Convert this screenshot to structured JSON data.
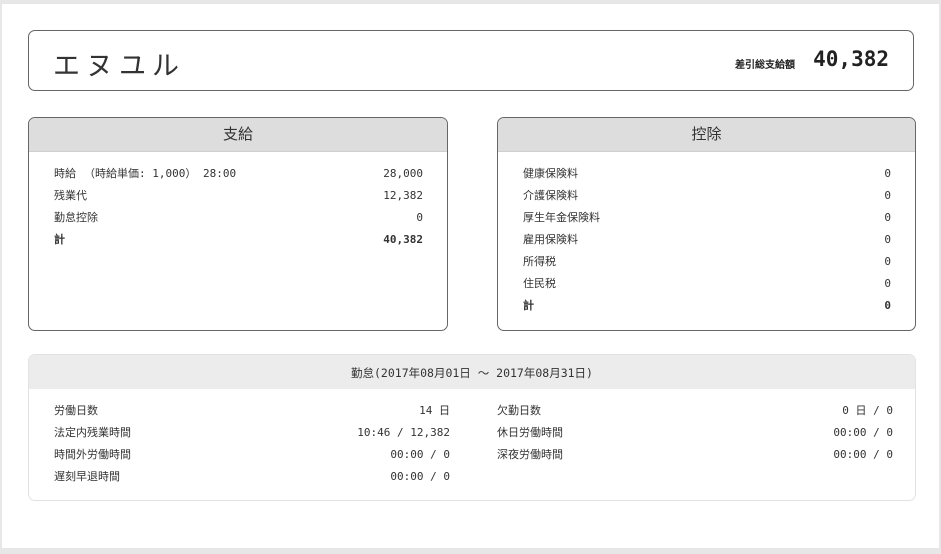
{
  "header": {
    "employee_name": "エヌユル",
    "net_pay_label": "差引総支給額",
    "net_pay_value": "40,382"
  },
  "payments": {
    "title": "支給",
    "hourly_label": "時給",
    "hourly_detail": "（時給単価: 1,000） 28:00",
    "items": [
      {
        "label": "時給",
        "value": "28,000"
      },
      {
        "label": "残業代",
        "value": "12,382"
      },
      {
        "label": "勤怠控除",
        "value": "0"
      }
    ],
    "total_label": "計",
    "total_value": "40,382"
  },
  "deductions": {
    "title": "控除",
    "items": [
      {
        "label": "健康保険料",
        "value": "0"
      },
      {
        "label": "介護保険料",
        "value": "0"
      },
      {
        "label": "厚生年金保険料",
        "value": "0"
      },
      {
        "label": "雇用保険料",
        "value": "0"
      },
      {
        "label": "所得税",
        "value": "0"
      },
      {
        "label": "住民税",
        "value": "0"
      }
    ],
    "total_label": "計",
    "total_value": "0"
  },
  "attendance": {
    "title": "勤怠(2017年08月01日 〜 2017年08月31日)",
    "left": [
      {
        "label": "労働日数",
        "value": "14 日"
      },
      {
        "label": "法定内残業時間",
        "value": "10:46 / 12,382"
      },
      {
        "label": "時間外労働時間",
        "value": "00:00 / 0"
      },
      {
        "label": "遅刻早退時間",
        "value": "00:00 / 0"
      }
    ],
    "right": [
      {
        "label": "欠勤日数",
        "value": "0 日 / 0"
      },
      {
        "label": "休日労働時間",
        "value": "00:00 / 0"
      },
      {
        "label": "深夜労働時間",
        "value": "00:00 / 0"
      }
    ]
  }
}
